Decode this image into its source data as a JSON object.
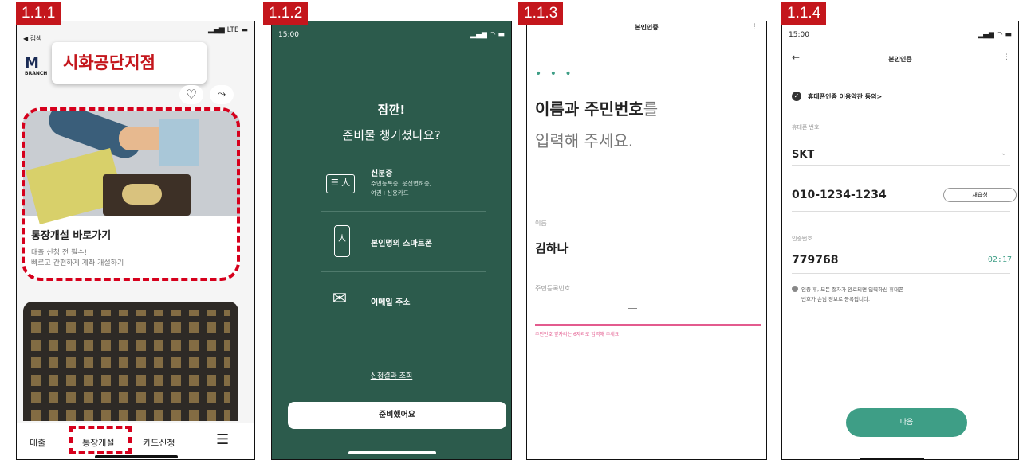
{
  "tags": [
    "1.1.1",
    "1.1.2",
    "1.1.3",
    "1.1.4"
  ],
  "colors": {
    "accent_red": "#c4161c",
    "dark_green": "#2c5b4c",
    "button_green": "#3e9e86",
    "pink_line": "#e35b8e",
    "timer": "#3e9e86"
  },
  "p1": {
    "back_label": "◀ 검색",
    "status_right": "LTE",
    "logo": "BRANCH",
    "branch_popup": "시화공단지점",
    "card1_title": "통장개설 바로가기",
    "card1_sub1": "대출 신청 전 필수!",
    "card1_sub2": "빠르고 간편하게 계좌 개설하기",
    "nav": [
      "대출",
      "통장개설",
      "카드신청"
    ]
  },
  "p2": {
    "time": "15:00",
    "title1": "잠깐!",
    "title2": "준비물 챙기셨나요?",
    "item1_title": "신분증",
    "item1_sub1": "주민등록증, 운전면허증,",
    "item1_sub2": "여권+신용카드",
    "item2_title": "본인명의 스마트폰",
    "item3_title": "이메일 주소",
    "link": "신청결과 조회",
    "button": "준비했어요"
  },
  "p3": {
    "header": "본인인증",
    "heading1a": "이름과 주민번호",
    "heading1b": "를",
    "heading2": "입력해 주세요.",
    "name_label": "이름",
    "name_value": "김하나",
    "rrn_label": "주민등록번호",
    "error": "주민번호 앞자리는 6자리로 입력해 주세요"
  },
  "p4": {
    "time": "15:00",
    "header": "본인인증",
    "agree": "휴대폰인증 이용약관 동의>",
    "phone_label": "휴대폰 번호",
    "carrier": "SKT",
    "phone": "010-1234-1234",
    "resend": "재요청",
    "code_label": "인증번호",
    "code": "779768",
    "timer": "02:17",
    "note1": "인증 후, 모든 절차가 완료되면 입력하신 휴대폰",
    "note2": "번호가 손님 정보로 등록됩니다.",
    "next": "다음"
  }
}
